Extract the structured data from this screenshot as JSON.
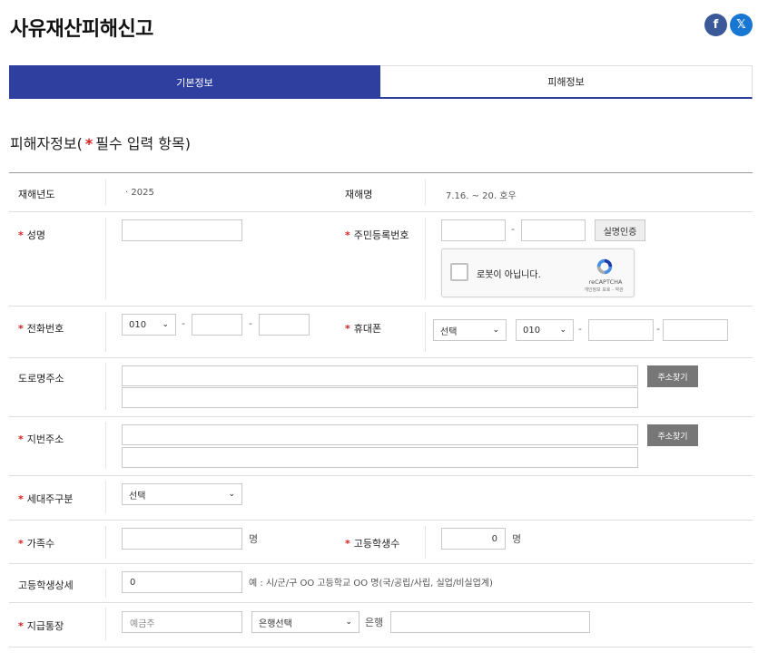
{
  "page_title": "사유재산피해신고",
  "sns": {
    "facebook_glyph": "f",
    "x_glyph": "𝕏"
  },
  "tabs": [
    {
      "label": "기본정보",
      "active": true
    },
    {
      "label": "피해정보",
      "active": false
    }
  ],
  "section": {
    "title_prefix": "피해자정보(",
    "required_mark": "*",
    "title_suffix": "필수 입력 항목)"
  },
  "form": {
    "year_label": "재해년도",
    "year_value": "· 2025",
    "disaster_label": "재해명",
    "disaster_value": "7.16. ~ 20. 호우",
    "name_label": "성명",
    "rrn_label": "주민등록번호",
    "rrn_dash": "-",
    "verify_button": "실명인증",
    "recaptcha_text": "로봇이 아닙니다.",
    "recaptcha_brand": "reCAPTCHA",
    "recaptcha_terms": "개인정보 보호 - 약관",
    "phone_label": "전화번호",
    "phone_prefix": "010",
    "dash": "-",
    "mobile_label": "휴대폰",
    "mobile_carrier": "선택",
    "mobile_prefix": "010",
    "road_address_label": "도로명주소",
    "find_address_button": "주소찾기",
    "lot_address_label": "지번주소",
    "household_label": "세대주구분",
    "household_value": "선택",
    "family_label": "가족수",
    "family_unit": "명",
    "hs_students_label": "고등학생수",
    "hs_students_value": "0",
    "hs_students_unit": "명",
    "hs_detail_label": "고등학생상세",
    "hs_detail_value": "0",
    "hs_detail_hint": "예 : 시/군/구 OO 고등학교 OO 명(국/공립/사립, 실업/비실업계)",
    "bank_account_label": "지급통장",
    "account_holder_placeholder": "예금주",
    "bank_select": "은행선택",
    "bank_unit": "은행"
  },
  "colors": {
    "primary": "#2e3fa0",
    "required": "#d72020",
    "button_gray": "#777777"
  }
}
